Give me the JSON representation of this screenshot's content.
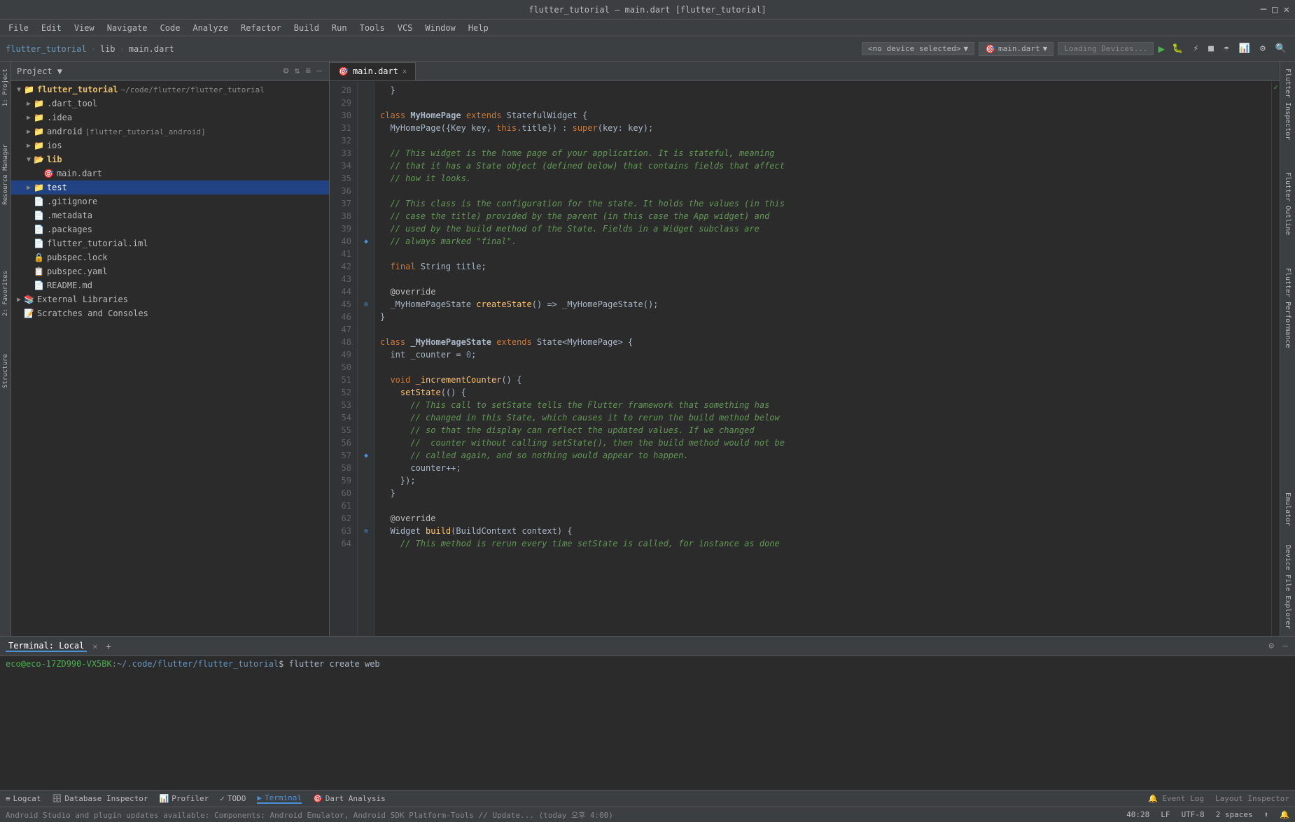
{
  "window": {
    "title": "flutter_tutorial – main.dart [flutter_tutorial]",
    "controls": [
      "minimize",
      "maximize",
      "close"
    ]
  },
  "menubar": {
    "items": [
      "File",
      "Edit",
      "View",
      "Navigate",
      "Code",
      "Analyze",
      "Refactor",
      "Build",
      "Run",
      "Tools",
      "VCS",
      "Window",
      "Help"
    ]
  },
  "toolbar": {
    "project_name": "flutter_tutorial",
    "breadcrumb_sep": "lib",
    "current_file": "main.dart",
    "device_select": "<no device selected>",
    "run_config": "main.dart",
    "loading": "Loading Devices..."
  },
  "project_panel": {
    "title": "Project",
    "dropdown_arrow": "▼",
    "items": [
      {
        "level": 0,
        "type": "folder-open",
        "label": "flutter_tutorial",
        "path": "~/code/flutter/flutter_tutorial",
        "arrow": "▼",
        "selected": false
      },
      {
        "level": 1,
        "type": "folder",
        "label": ".dart_tool",
        "arrow": "▶",
        "selected": false
      },
      {
        "level": 1,
        "type": "folder",
        "label": ".idea",
        "arrow": "▶",
        "selected": false
      },
      {
        "level": 1,
        "type": "folder",
        "label": "android",
        "path": "[flutter_tutorial_android]",
        "arrow": "▶",
        "selected": false
      },
      {
        "level": 1,
        "type": "folder",
        "label": "ios",
        "arrow": "▶",
        "selected": false
      },
      {
        "level": 1,
        "type": "folder-open",
        "label": "lib",
        "arrow": "▼",
        "selected": false
      },
      {
        "level": 2,
        "type": "file-dart",
        "label": "main.dart",
        "arrow": "",
        "selected": false
      },
      {
        "level": 1,
        "type": "folder",
        "label": "test",
        "arrow": "▶",
        "selected": true
      },
      {
        "level": 1,
        "type": "file",
        "label": ".gitignore",
        "arrow": "",
        "selected": false
      },
      {
        "level": 1,
        "type": "file",
        "label": ".metadata",
        "arrow": "",
        "selected": false
      },
      {
        "level": 1,
        "type": "file",
        "label": ".packages",
        "arrow": "",
        "selected": false
      },
      {
        "level": 1,
        "type": "file",
        "label": "flutter_tutorial.iml",
        "arrow": "",
        "selected": false
      },
      {
        "level": 1,
        "type": "file",
        "label": "pubspec.lock",
        "arrow": "",
        "selected": false
      },
      {
        "level": 1,
        "type": "file-yaml",
        "label": "pubspec.yaml",
        "arrow": "",
        "selected": false
      },
      {
        "level": 1,
        "type": "file",
        "label": "README.md",
        "arrow": "",
        "selected": false
      },
      {
        "level": 0,
        "type": "folder",
        "label": "External Libraries",
        "arrow": "▶",
        "selected": false
      },
      {
        "level": 0,
        "type": "folder",
        "label": "Scratches and Consoles",
        "arrow": "",
        "selected": false
      }
    ]
  },
  "editor": {
    "tabs": [
      {
        "label": "main.dart",
        "active": true,
        "modified": false
      }
    ],
    "lines": [
      {
        "num": 28,
        "gutter": "",
        "code": "  }"
      },
      {
        "num": 29,
        "gutter": "",
        "code": ""
      },
      {
        "num": 30,
        "gutter": "",
        "code": "class MyHomePage extends StatefulWidget {"
      },
      {
        "num": 31,
        "gutter": "",
        "code": "  MyHomePage({Key key, this.title}) : super(key: key);"
      },
      {
        "num": 32,
        "gutter": "",
        "code": ""
      },
      {
        "num": 33,
        "gutter": "",
        "code": "  // This widget is the home page of your application. It is stateful, meaning"
      },
      {
        "num": 34,
        "gutter": "",
        "code": "  // that it has a State object (defined below) that contains fields that affect"
      },
      {
        "num": 35,
        "gutter": "",
        "code": "  // how it looks."
      },
      {
        "num": 36,
        "gutter": "",
        "code": ""
      },
      {
        "num": 37,
        "gutter": "",
        "code": "  // This class is the configuration for the state. It holds the values (in this"
      },
      {
        "num": 38,
        "gutter": "",
        "code": "  // case the title) provided by the parent (in this case the App widget) and"
      },
      {
        "num": 39,
        "gutter": "",
        "code": "  // used by the build method of the State. Fields in a Widget subclass are"
      },
      {
        "num": 40,
        "gutter": "◆",
        "code": "  // always marked \"final\"."
      },
      {
        "num": 41,
        "gutter": "",
        "code": ""
      },
      {
        "num": 42,
        "gutter": "",
        "code": "  final String title;"
      },
      {
        "num": 43,
        "gutter": "",
        "code": ""
      },
      {
        "num": 44,
        "gutter": "",
        "code": "  @override"
      },
      {
        "num": 45,
        "gutter": "⊙",
        "code": "  _MyHomePageState createState() => _MyHomePageState();"
      },
      {
        "num": 46,
        "gutter": "",
        "code": "}"
      },
      {
        "num": 47,
        "gutter": "",
        "code": ""
      },
      {
        "num": 48,
        "gutter": "",
        "code": "class _MyHomePageState extends State<MyHomePage> {"
      },
      {
        "num": 49,
        "gutter": "",
        "code": "  int _counter = 0;"
      },
      {
        "num": 50,
        "gutter": "",
        "code": ""
      },
      {
        "num": 51,
        "gutter": "",
        "code": "  void _incrementCounter() {"
      },
      {
        "num": 52,
        "gutter": "",
        "code": "    setState(() {"
      },
      {
        "num": 53,
        "gutter": "",
        "code": "      // This call to setState tells the Flutter framework that something has"
      },
      {
        "num": 54,
        "gutter": "",
        "code": "      // changed in this State, which causes it to rerun the build method below"
      },
      {
        "num": 55,
        "gutter": "",
        "code": "      // so that the display can reflect the updated values. If we changed"
      },
      {
        "num": 56,
        "gutter": "",
        "code": "      //  counter without calling setState(), then the build method would not be"
      },
      {
        "num": 57,
        "gutter": "◆",
        "code": "      // called again, and so nothing would appear to happen."
      },
      {
        "num": 58,
        "gutter": "",
        "code": "      counter++;"
      },
      {
        "num": 59,
        "gutter": "",
        "code": "    });"
      },
      {
        "num": 60,
        "gutter": "",
        "code": "  }"
      },
      {
        "num": 61,
        "gutter": "",
        "code": ""
      },
      {
        "num": 62,
        "gutter": "",
        "code": "  @override"
      },
      {
        "num": 63,
        "gutter": "⊙",
        "code": "  Widget build(BuildContext context) {"
      },
      {
        "num": 64,
        "gutter": "",
        "code": "    // This method is rerun every time setState is called, for instance as done"
      }
    ]
  },
  "terminal": {
    "tabs": [
      "Terminal: Local",
      "+"
    ],
    "prompt": "eco@eco-17ZD990-VX5BK",
    "path": "~/.code/flutter/flutter_tutorial",
    "command": "flutter create web",
    "controls": [
      "gear",
      "minimize"
    ]
  },
  "right_sidebar": {
    "tabs": [
      "Flutter Inspector",
      "Flutter Outline",
      "Flutter Performance"
    ]
  },
  "bottom_tools": [
    {
      "label": "Logcat",
      "icon": "≡"
    },
    {
      "label": "Database Inspector",
      "icon": "🗄"
    },
    {
      "label": "Profiler",
      "icon": "📊"
    },
    {
      "label": "TODO",
      "icon": "✓"
    },
    {
      "label": "Terminal",
      "icon": "▶",
      "active": true
    },
    {
      "label": "Dart Analysis",
      "icon": "🎯"
    }
  ],
  "status_bar": {
    "message": "Android Studio and plugin updates available: Components: Android Emulator, Android SDK Platform-Tools // Update... (today 오후 4:00)",
    "line_col": "40:28",
    "encoding": "LF",
    "charset": "UTF-8",
    "indent": "2 spaces"
  },
  "layout_inspector": "Layout Inspector"
}
